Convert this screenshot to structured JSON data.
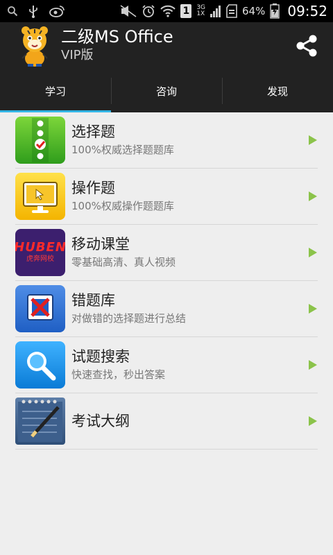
{
  "status_bar": {
    "net_type": "3G",
    "net_sub": "1X",
    "battery": "64%",
    "time": "09:52",
    "sim": "1"
  },
  "header": {
    "title": "二级MS Office",
    "subtitle": "VIP版",
    "share_icon": "share-icon"
  },
  "tabs": [
    {
      "label": "学习",
      "active": true
    },
    {
      "label": "咨询",
      "active": false
    },
    {
      "label": "发现",
      "active": false
    }
  ],
  "items": [
    {
      "title": "选择题",
      "subtitle": "100%权威选择题题库",
      "icon": "choice-icon"
    },
    {
      "title": "操作题",
      "subtitle": "100%权威操作题题库",
      "icon": "monitor-icon"
    },
    {
      "title": "移动课堂",
      "subtitle": "零基础高清、真人视频",
      "icon": "huben-logo",
      "logo_text": "HUBEN",
      "logo_sub": "虎奔网校"
    },
    {
      "title": "错题库",
      "subtitle": "对做错的选择题进行总结",
      "icon": "wrong-icon"
    },
    {
      "title": "试题搜索",
      "subtitle": "快速查找，秒出答案",
      "icon": "search-icon"
    },
    {
      "title": "考试大纲",
      "subtitle": "",
      "icon": "notebook-icon"
    }
  ],
  "colors": {
    "accent": "#33b5e5",
    "arrow": "#8bc34a",
    "bar_bg": "#222222"
  }
}
